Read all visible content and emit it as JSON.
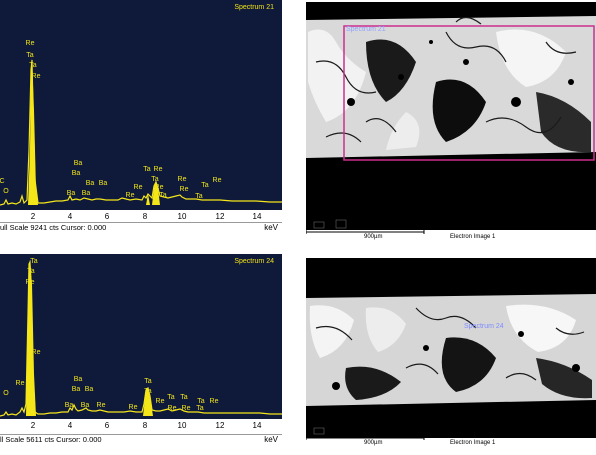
{
  "top": {
    "spectrum_title": "Spectrum 21",
    "status": "ull Scale 9241 cts Cursor: 0.000",
    "unit": "keV",
    "x_ticks": [
      "2",
      "4",
      "6",
      "8",
      "10",
      "12",
      "14"
    ],
    "peak_labels": [
      "Re",
      "Ta",
      "Ta",
      "Re",
      "C",
      "O",
      "Ba",
      "Ba",
      "Ba",
      "Ba",
      "Ba",
      "Ba",
      "Ta",
      "Re",
      "Re",
      "Ta",
      "Re",
      "Re",
      "Ta",
      "Re",
      "Re",
      "Ta",
      "Re",
      "Ta"
    ]
  },
  "bottom": {
    "spectrum_title": "Spectrum 24",
    "status": "ll Scale 5611 cts Cursor: 0.000",
    "unit": "keV",
    "x_ticks": [
      "2",
      "4",
      "6",
      "8",
      "10",
      "12",
      "14"
    ],
    "peak_labels": [
      "Ta",
      "Ta",
      "Re",
      "Re",
      "O",
      "Re",
      "Ba",
      "Ba",
      "Ba",
      "Ba",
      "Ba",
      "Re",
      "Ta",
      "Ta",
      "Re",
      "Re",
      "Ta",
      "Re",
      "Ta",
      "Re",
      "Ta",
      "Ta",
      "Re"
    ]
  },
  "sem_top": {
    "roi_label": "Spectrum 21",
    "scale_label": "900µm",
    "image_label": "Electron Image 1"
  },
  "sem_bottom": {
    "roi_label": "Spectrum 24",
    "scale_label": "900µm",
    "image_label": "Electron Image 1"
  },
  "colors": {
    "plot_bg": "#0f1a3a",
    "spectrum": "#f5e61a",
    "roi_box": "#cc2f8e"
  }
}
